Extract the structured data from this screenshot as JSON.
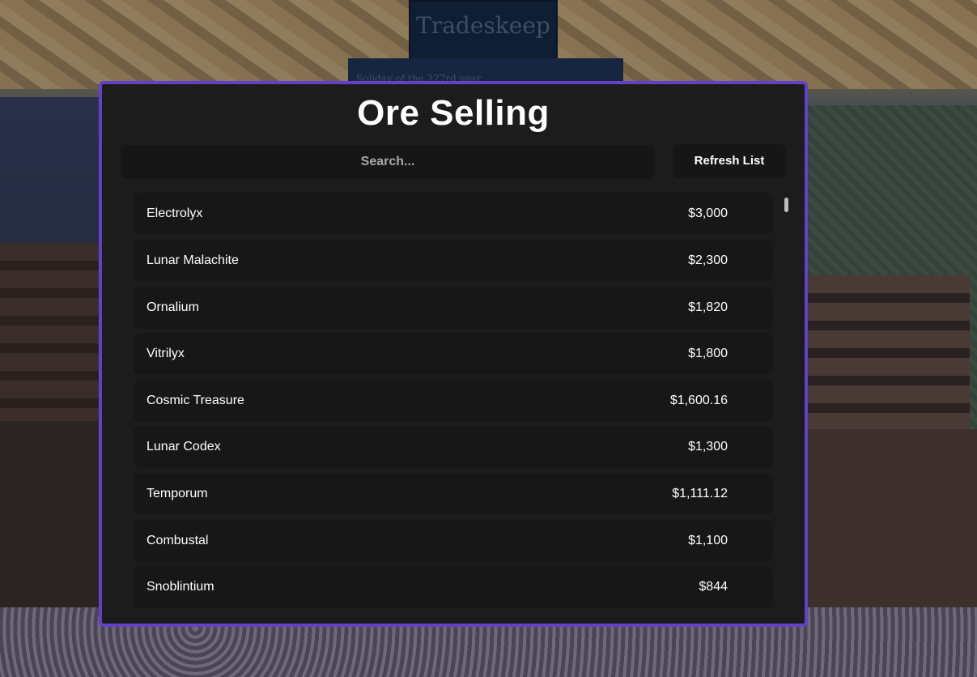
{
  "background": {
    "sign_text": "Tradeskeep",
    "banner_text": "Soliday of the 227rd year"
  },
  "panel": {
    "title": "Ore Selling",
    "search_placeholder": "Search...",
    "refresh_label": "Refresh List",
    "border_color": "#6240c8"
  },
  "ores": [
    {
      "name": "Electrolyx",
      "price": "$3,000"
    },
    {
      "name": "Lunar Malachite",
      "price": "$2,300"
    },
    {
      "name": "Ornalium",
      "price": "$1,820"
    },
    {
      "name": "Vitrilyx",
      "price": "$1,800"
    },
    {
      "name": "Cosmic Treasure",
      "price": "$1,600.16"
    },
    {
      "name": "Lunar Codex",
      "price": "$1,300"
    },
    {
      "name": "Temporum",
      "price": "$1,111.12"
    },
    {
      "name": "Combustal",
      "price": "$1,100"
    },
    {
      "name": "Snoblintium",
      "price": "$844"
    }
  ]
}
